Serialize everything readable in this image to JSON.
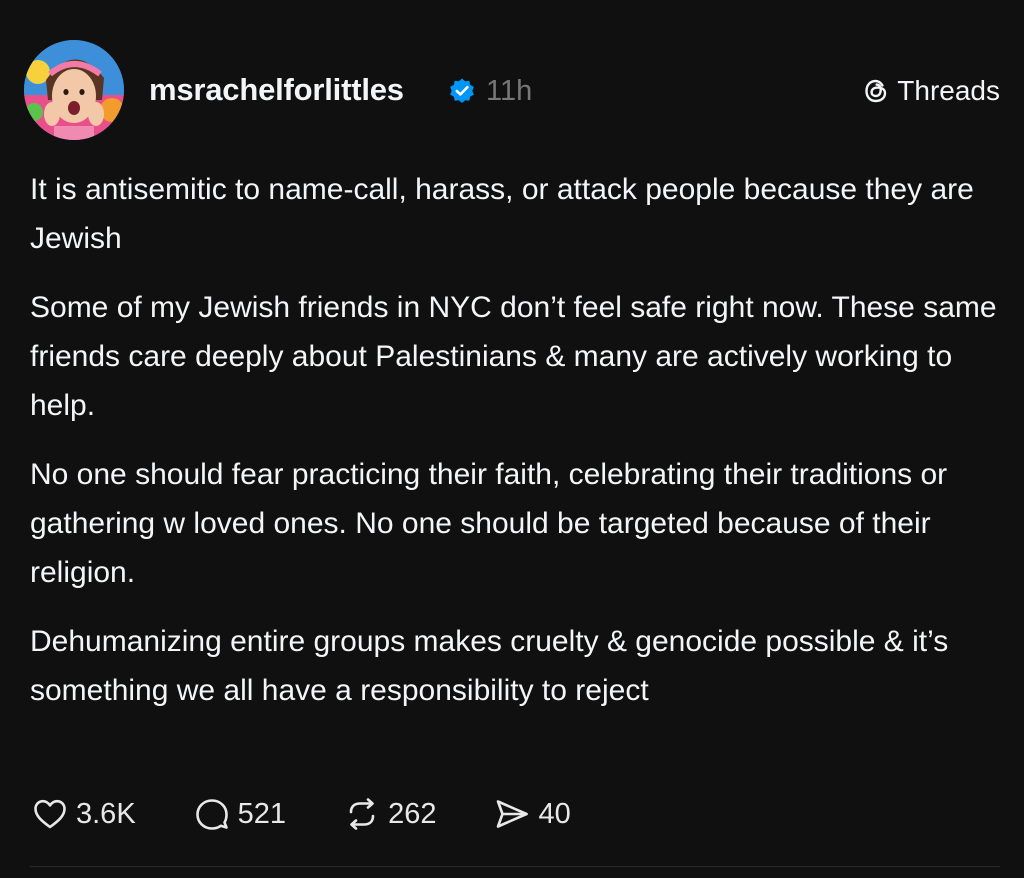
{
  "post": {
    "username": "msrachelforlittles",
    "verified": true,
    "time": "11h",
    "brand": "Threads",
    "paragraphs": [
      "It is antisemitic to name-call, harass, or attack people because they are Jewish",
      "Some of my Jewish friends in NYC don’t feel safe right now. These same friends care deeply about Palestinians & many are actively working to help.",
      "No one should fear practicing their faith, celebrating their traditions or gathering w loved ones. No one should be targeted because of their religion.",
      "Dehumanizing entire groups makes cruelty & genocide possible & it’s something we all have a responsibility to reject"
    ],
    "actions": {
      "likes": "3.6K",
      "replies": "521",
      "reposts": "262",
      "shares": "40"
    }
  },
  "icons": {
    "avatar": "avatar",
    "verified": "verified-badge-icon",
    "brand": "threads-logo-icon",
    "like": "heart-icon",
    "reply": "comment-bubble-icon",
    "repost": "repost-icon",
    "share": "send-icon"
  },
  "colors": {
    "background": "#101010",
    "text": "#f3f5f7",
    "muted": "#777777",
    "verified": "#0095f6"
  }
}
